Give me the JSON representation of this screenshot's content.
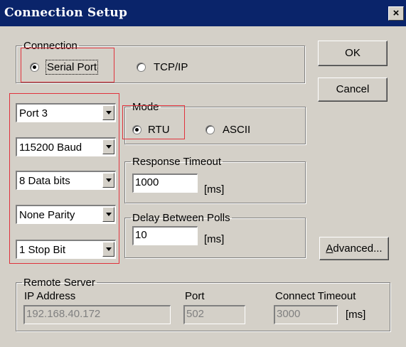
{
  "window": {
    "title": "Connection Setup",
    "close_label": "×"
  },
  "connection": {
    "legend": "Connection",
    "serial_label": "Serial Port",
    "tcpip_label": "TCP/IP",
    "selected": "Serial Port"
  },
  "buttons": {
    "ok_label": "OK",
    "cancel_label": "Cancel",
    "advanced_prefix": "A",
    "advanced_rest": "dvanced..."
  },
  "serial_settings": {
    "port": "Port 3",
    "baud": "115200 Baud",
    "data_bits": "8 Data bits",
    "parity": "None Parity",
    "stop_bits": "1 Stop Bit"
  },
  "mode": {
    "legend": "Mode",
    "rtu_label": "RTU",
    "ascii_label": "ASCII",
    "selected": "RTU"
  },
  "response_timeout": {
    "legend": "Response Timeout",
    "value": "1000",
    "unit": "[ms]"
  },
  "delay_between_polls": {
    "legend": "Delay Between Polls",
    "value": "10",
    "unit": "[ms]"
  },
  "remote_server": {
    "legend": "Remote Server",
    "ip_label": "IP Address",
    "ip_value": "192.168.40.172",
    "port_label": "Port",
    "port_value": "502",
    "timeout_label": "Connect Timeout",
    "timeout_value": "3000",
    "timeout_unit": "[ms]"
  },
  "colors": {
    "titlebar": "#0a246a",
    "dialog_face": "#d4d0c8",
    "highlight_box": "#e0323c"
  }
}
